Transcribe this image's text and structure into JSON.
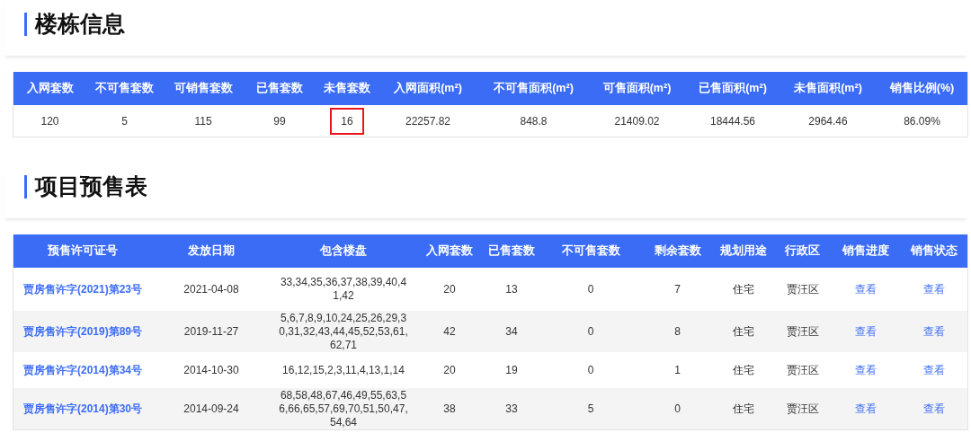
{
  "building_info": {
    "title": "楼栋信息",
    "columns": [
      "入网套数",
      "不可售套数",
      "可销售套数",
      "已售套数",
      "未售套数",
      "入网面积(m²)",
      "不可售面积(m²)",
      "可售面积(m²)",
      "已售面积(m²)",
      "未售面积(m²)",
      "销售比例(%)"
    ],
    "values": [
      {
        "text": "120",
        "highlighted": false
      },
      {
        "text": "5",
        "highlighted": false
      },
      {
        "text": "115",
        "highlighted": false
      },
      {
        "text": "99",
        "highlighted": false
      },
      {
        "text": "16",
        "highlighted": true
      },
      {
        "text": "22257.82",
        "highlighted": false
      },
      {
        "text": "848.8",
        "highlighted": false
      },
      {
        "text": "21409.02",
        "highlighted": false
      },
      {
        "text": "18444.56",
        "highlighted": false
      },
      {
        "text": "2964.46",
        "highlighted": false
      },
      {
        "text": "86.09%",
        "highlighted": false
      }
    ]
  },
  "presale_table": {
    "title": "项目预售表",
    "columns": [
      "预售许可证号",
      "发放日期",
      "包含楼盘",
      "入网套数",
      "已售套数",
      "不可售套数",
      "剩余套数",
      "规划用途",
      "行政区",
      "销售进度",
      "销售状态"
    ],
    "rows": [
      {
        "license": "贾房售许字(2021)第23号",
        "date": "2021-04-08",
        "buildings": "33,34,35,36,37,38,39,40,41,42",
        "units": "20",
        "sold": "13",
        "unsellable": "0",
        "remaining": "7",
        "usage": "住宅",
        "district": "贾汪区",
        "progress": "查看",
        "status": "查看"
      },
      {
        "license": "贾房售许字(2019)第89号",
        "date": "2019-11-27",
        "buildings": "5,6,7,8,9,10,24,25,26,29,30,31,32,43,44,45,52,53,61,62,71",
        "units": "42",
        "sold": "34",
        "unsellable": "0",
        "remaining": "8",
        "usage": "住宅",
        "district": "贾汪区",
        "progress": "查看",
        "status": "查看"
      },
      {
        "license": "贾房售许字(2014)第34号",
        "date": "2014-10-30",
        "buildings": "16,12,15,2,3,11,4,13,1,14",
        "units": "20",
        "sold": "19",
        "unsellable": "0",
        "remaining": "1",
        "usage": "住宅",
        "district": "贾汪区",
        "progress": "查看",
        "status": "查看"
      },
      {
        "license": "贾房售许字(2014)第30号",
        "date": "2014-09-24",
        "buildings": "68,58,48,67,46,49,55,63,56,66,65,57,69,70,51,50,47,54,64",
        "units": "38",
        "sold": "33",
        "unsellable": "5",
        "remaining": "0",
        "usage": "住宅",
        "district": "贾汪区",
        "progress": "查看",
        "status": "查看"
      }
    ]
  }
}
